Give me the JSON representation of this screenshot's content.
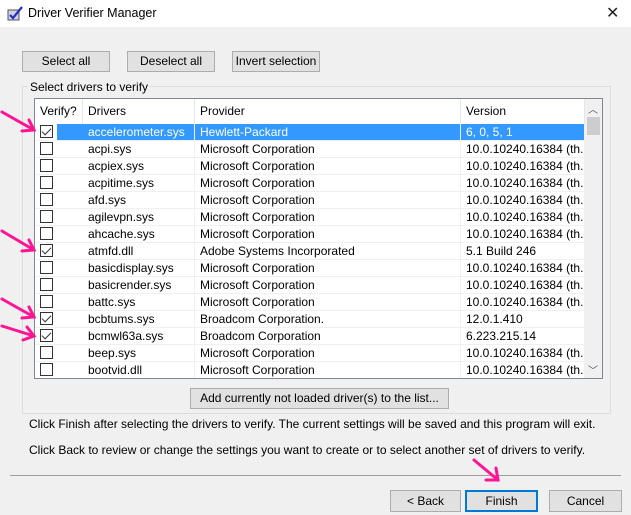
{
  "window": {
    "title": "Driver Verifier Manager",
    "icon": "driver-verifier-check-icon",
    "close_icon": "close-icon"
  },
  "toolbar": {
    "select_all": "Select all",
    "deselect_all": "Deselect all",
    "invert_selection": "Invert selection"
  },
  "group": {
    "label": "Select drivers to verify"
  },
  "table": {
    "columns": [
      "Verify?",
      "Drivers",
      "Provider",
      "Version"
    ],
    "rows": [
      {
        "checked": true,
        "driver": "accelerometer.sys",
        "provider": "Hewlett-Packard",
        "version": "6, 0, 5, 1",
        "selected": true
      },
      {
        "checked": false,
        "driver": "acpi.sys",
        "provider": "Microsoft Corporation",
        "version": "10.0.10240.16384 (th..."
      },
      {
        "checked": false,
        "driver": "acpiex.sys",
        "provider": "Microsoft Corporation",
        "version": "10.0.10240.16384 (th..."
      },
      {
        "checked": false,
        "driver": "acpitime.sys",
        "provider": "Microsoft Corporation",
        "version": "10.0.10240.16384 (th..."
      },
      {
        "checked": false,
        "driver": "afd.sys",
        "provider": "Microsoft Corporation",
        "version": "10.0.10240.16384 (th..."
      },
      {
        "checked": false,
        "driver": "agilevpn.sys",
        "provider": "Microsoft Corporation",
        "version": "10.0.10240.16384 (th..."
      },
      {
        "checked": false,
        "driver": "ahcache.sys",
        "provider": "Microsoft Corporation",
        "version": "10.0.10240.16384 (th..."
      },
      {
        "checked": true,
        "driver": "atmfd.dll",
        "provider": "Adobe Systems Incorporated",
        "version": "5.1 Build 246"
      },
      {
        "checked": false,
        "driver": "basicdisplay.sys",
        "provider": "Microsoft Corporation",
        "version": "10.0.10240.16384 (th..."
      },
      {
        "checked": false,
        "driver": "basicrender.sys",
        "provider": "Microsoft Corporation",
        "version": "10.0.10240.16384 (th..."
      },
      {
        "checked": false,
        "driver": "battc.sys",
        "provider": "Microsoft Corporation",
        "version": "10.0.10240.16384 (th..."
      },
      {
        "checked": true,
        "driver": "bcbtums.sys",
        "provider": "Broadcom Corporation.",
        "version": "12.0.1.410"
      },
      {
        "checked": true,
        "driver": "bcmwl63a.sys",
        "provider": "Broadcom Corporation",
        "version": "6.223.215.14"
      },
      {
        "checked": false,
        "driver": "beep.sys",
        "provider": "Microsoft Corporation",
        "version": "10.0.10240.16384 (th..."
      },
      {
        "checked": false,
        "driver": "bootvid.dll",
        "provider": "Microsoft Corporation",
        "version": "10.0.10240.16384 (th..."
      }
    ]
  },
  "add_button": "Add currently not loaded driver(s) to the list...",
  "info": {
    "line1": "Click Finish after selecting the drivers to verify. The current settings will be saved and this program will exit.",
    "line2": "Click Back to review or change the settings you want to create or to select another set of drivers to verify."
  },
  "footer": {
    "back": "< Back",
    "finish": "Finish",
    "cancel": "Cancel"
  },
  "colors": {
    "selection": "#3399ff",
    "annotation_arrow": "#ff1493",
    "default_button_border": "#0078d7"
  }
}
